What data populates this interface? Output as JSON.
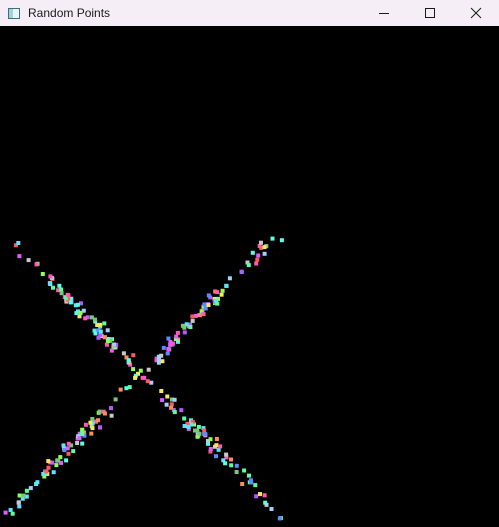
{
  "window": {
    "title": "Random Points",
    "controls": {
      "minimize_icon": "minimize-icon",
      "maximize_icon": "maximize-icon",
      "close_icon": "close-icon"
    }
  },
  "canvas": {
    "background": "#000000",
    "point_colors": [
      "#ff5ab4",
      "#5affa0",
      "#5a8cff",
      "#ffe65a",
      "#b45aff",
      "#5ae6ff",
      "#ff8c5a",
      "#8cff5a",
      "#c8c8c8",
      "#ff5a5a",
      "#5affe6",
      "#e65aff",
      "#a0d2ff",
      "#78c878"
    ]
  }
}
